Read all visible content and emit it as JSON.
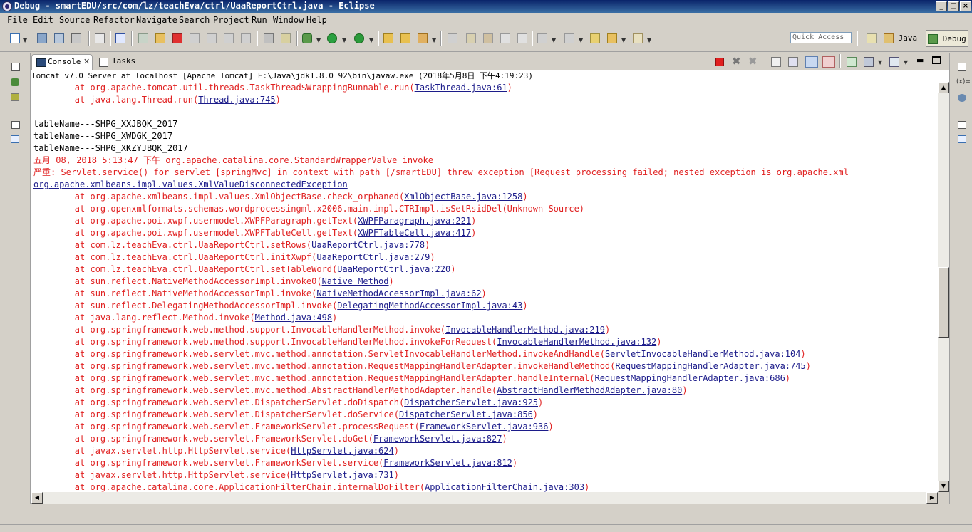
{
  "window": {
    "title": "Debug - smartEDU/src/com/lz/teachEva/ctrl/UaaReportCtrl.java - Eclipse",
    "controls": [
      "_",
      "□",
      "×"
    ]
  },
  "menu": [
    "File",
    "Edit",
    "Source",
    "Refactor",
    "Navigate",
    "Search",
    "Project",
    "Run",
    "Window",
    "Help"
  ],
  "toolbar": {
    "quick_access_placeholder": "Quick Access",
    "perspectives": [
      {
        "label": "Java",
        "icon": "java-perspective-icon"
      },
      {
        "label": "Debug",
        "icon": "debug-perspective-icon",
        "active": true
      }
    ]
  },
  "view": {
    "tabs": [
      {
        "label": "Console",
        "active": true,
        "icon": "console-icon"
      },
      {
        "label": "Tasks",
        "active": false,
        "icon": "tasks-icon"
      }
    ],
    "process_label": "Tomcat v7.0 Server at localhost [Apache Tomcat] E:\\Java\\jdk1.8.0_92\\bin\\javaw.exe (2018年5月8日 下午4:19:23)"
  },
  "console_lines": [
    {
      "type": "err",
      "text": "        at org.apache.tomcat.util.threads.TaskThread$WrappingRunnable.run(",
      "link": "TaskThread.java:61",
      "tail": ")"
    },
    {
      "type": "err",
      "text": "        at java.lang.Thread.run(",
      "link": "Thread.java:745",
      "tail": ")"
    },
    {
      "type": "out",
      "text": ""
    },
    {
      "type": "out",
      "text": "tableName---SHPG_XXJBQK_2017"
    },
    {
      "type": "out",
      "text": "tableName---SHPG_XWDGK_2017"
    },
    {
      "type": "out",
      "text": "tableName---SHPG_XKZYJBQK_2017"
    },
    {
      "type": "err",
      "text": "五月 08, 2018 5:13:47 下午 org.apache.catalina.core.StandardWrapperValve invoke"
    },
    {
      "type": "err",
      "text": "严重: Servlet.service() for servlet [springMvc] in context with path [/smartEDU] threw exception [Request processing failed; nested exception is org.apache.xml"
    },
    {
      "type": "lnkline",
      "text": "",
      "link": "org.apache.xmlbeans.impl.values.XmlValueDisconnectedException",
      "tail": ""
    },
    {
      "type": "err",
      "text": "        at org.apache.xmlbeans.impl.values.XmlObjectBase.check_orphaned(",
      "link": "XmlObjectBase.java:1258",
      "tail": ")"
    },
    {
      "type": "err",
      "text": "        at org.openxmlformats.schemas.wordprocessingml.x2006.main.impl.CTRImpl.isSetRsidDel(Unknown Source)"
    },
    {
      "type": "err",
      "text": "        at org.apache.poi.xwpf.usermodel.XWPFParagraph.getText(",
      "link": "XWPFParagraph.java:221",
      "tail": ")"
    },
    {
      "type": "err",
      "text": "        at org.apache.poi.xwpf.usermodel.XWPFTableCell.getText(",
      "link": "XWPFTableCell.java:417",
      "tail": ")"
    },
    {
      "type": "err",
      "text": "        at com.lz.teachEva.ctrl.UaaReportCtrl.setRows(",
      "link": "UaaReportCtrl.java:778",
      "tail": ")"
    },
    {
      "type": "err",
      "text": "        at com.lz.teachEva.ctrl.UaaReportCtrl.initXwpf(",
      "link": "UaaReportCtrl.java:279",
      "tail": ")"
    },
    {
      "type": "err",
      "text": "        at com.lz.teachEva.ctrl.UaaReportCtrl.setTableWord(",
      "link": "UaaReportCtrl.java:220",
      "tail": ")"
    },
    {
      "type": "err",
      "text": "        at sun.reflect.NativeMethodAccessorImpl.invoke0(",
      "link": "Native Method",
      "tail": ")"
    },
    {
      "type": "err",
      "text": "        at sun.reflect.NativeMethodAccessorImpl.invoke(",
      "link": "NativeMethodAccessorImpl.java:62",
      "tail": ")"
    },
    {
      "type": "err",
      "text": "        at sun.reflect.DelegatingMethodAccessorImpl.invoke(",
      "link": "DelegatingMethodAccessorImpl.java:43",
      "tail": ")"
    },
    {
      "type": "err",
      "text": "        at java.lang.reflect.Method.invoke(",
      "link": "Method.java:498",
      "tail": ")"
    },
    {
      "type": "err",
      "text": "        at org.springframework.web.method.support.InvocableHandlerMethod.invoke(",
      "link": "InvocableHandlerMethod.java:219",
      "tail": ")"
    },
    {
      "type": "err",
      "text": "        at org.springframework.web.method.support.InvocableHandlerMethod.invokeForRequest(",
      "link": "InvocableHandlerMethod.java:132",
      "tail": ")"
    },
    {
      "type": "err",
      "text": "        at org.springframework.web.servlet.mvc.method.annotation.ServletInvocableHandlerMethod.invokeAndHandle(",
      "link": "ServletInvocableHandlerMethod.java:104",
      "tail": ")"
    },
    {
      "type": "err",
      "text": "        at org.springframework.web.servlet.mvc.method.annotation.RequestMappingHandlerAdapter.invokeHandleMethod(",
      "link": "RequestMappingHandlerAdapter.java:745",
      "tail": ")"
    },
    {
      "type": "err",
      "text": "        at org.springframework.web.servlet.mvc.method.annotation.RequestMappingHandlerAdapter.handleInternal(",
      "link": "RequestMappingHandlerAdapter.java:686",
      "tail": ")"
    },
    {
      "type": "err",
      "text": "        at org.springframework.web.servlet.mvc.method.AbstractHandlerMethodAdapter.handle(",
      "link": "AbstractHandlerMethodAdapter.java:80",
      "tail": ")"
    },
    {
      "type": "err",
      "text": "        at org.springframework.web.servlet.DispatcherServlet.doDispatch(",
      "link": "DispatcherServlet.java:925",
      "tail": ")"
    },
    {
      "type": "err",
      "text": "        at org.springframework.web.servlet.DispatcherServlet.doService(",
      "link": "DispatcherServlet.java:856",
      "tail": ")"
    },
    {
      "type": "err",
      "text": "        at org.springframework.web.servlet.FrameworkServlet.processRequest(",
      "link": "FrameworkServlet.java:936",
      "tail": ")"
    },
    {
      "type": "err",
      "text": "        at org.springframework.web.servlet.FrameworkServlet.doGet(",
      "link": "FrameworkServlet.java:827",
      "tail": ")"
    },
    {
      "type": "err",
      "text": "        at javax.servlet.http.HttpServlet.service(",
      "link": "HttpServlet.java:624",
      "tail": ")"
    },
    {
      "type": "err",
      "text": "        at org.springframework.web.servlet.FrameworkServlet.service(",
      "link": "FrameworkServlet.java:812",
      "tail": ")"
    },
    {
      "type": "err",
      "text": "        at javax.servlet.http.HttpServlet.service(",
      "link": "HttpServlet.java:731",
      "tail": ")"
    },
    {
      "type": "err",
      "text": "        at org.apache.catalina.core.ApplicationFilterChain.internalDoFilter(",
      "link": "ApplicationFilterChain.java:303",
      "tail": ")"
    }
  ],
  "colors": {
    "stderr": "#e02020",
    "stdout": "#000000",
    "link": "#1c1c8a",
    "chrome": "#d4d0c8"
  }
}
